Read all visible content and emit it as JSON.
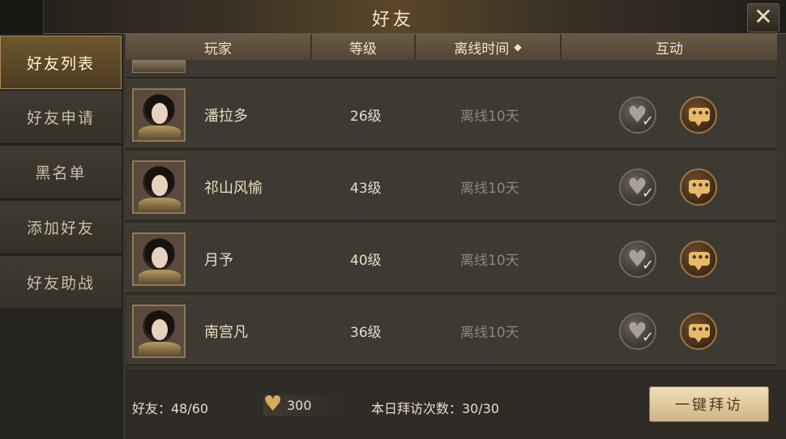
{
  "window": {
    "title": "好友",
    "close_label": "✕"
  },
  "sidebar": {
    "tabs": [
      {
        "label": "好友列表",
        "active": true
      },
      {
        "label": "好友申请",
        "active": false
      },
      {
        "label": "黑名单",
        "active": false
      },
      {
        "label": "添加好友",
        "active": false
      },
      {
        "label": "好友助战",
        "active": false
      }
    ]
  },
  "table": {
    "headers": {
      "player": "玩家",
      "level": "等级",
      "offline_time": "离线时间",
      "interact": "互动"
    },
    "rows": [
      {
        "name": "潘拉多",
        "level": "26级",
        "offline": "离线10天"
      },
      {
        "name": "祁山风愉",
        "level": "43级",
        "offline": "离线10天"
      },
      {
        "name": "月予",
        "level": "40级",
        "offline": "离线10天"
      },
      {
        "name": "南宫凡",
        "level": "36级",
        "offline": "离线10天"
      }
    ]
  },
  "footer": {
    "friends_label": "好友：48/60",
    "hearts": "300",
    "visits_label": "本日拜访次数：30/30",
    "visit_all_button": "一键拜访"
  },
  "icons": {
    "close": "close-icon",
    "sort": "sort-icon",
    "heart": "heart-icon",
    "chat": "chat-bubble-icon"
  },
  "colors": {
    "accent_gold": "#cfb486",
    "active_tab": "#6e5730",
    "heart_gold": "#d9a95c"
  }
}
